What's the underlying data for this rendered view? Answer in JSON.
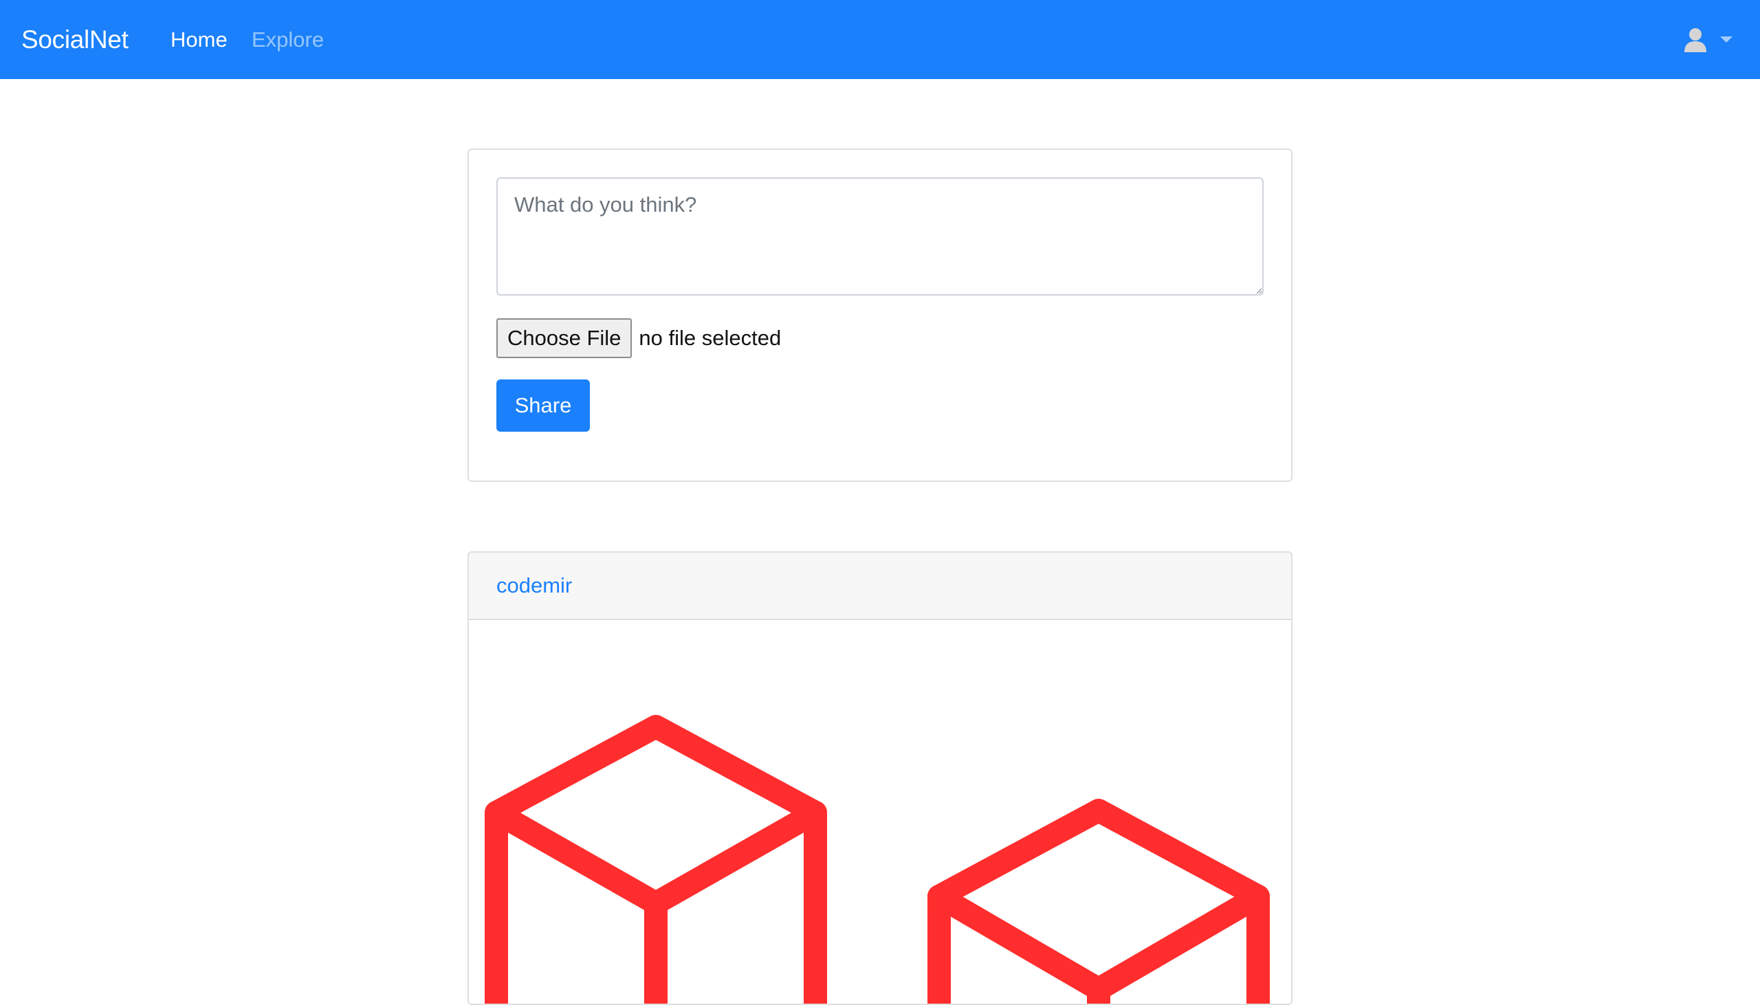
{
  "navbar": {
    "brand": "SocialNet",
    "links": [
      {
        "label": "Home",
        "active": true
      },
      {
        "label": "Explore",
        "active": false
      }
    ],
    "user_icon": "user-icon",
    "caret_icon": "caret-down-icon",
    "background_color": "#1a80fb"
  },
  "composer": {
    "placeholder": "What do you think?",
    "value": "",
    "file_button_label": "Choose File",
    "file_status": "no file selected",
    "share_label": "Share"
  },
  "feed": {
    "posts": [
      {
        "author": "codemir",
        "image": "laravel-logo-red-cubes",
        "image_color": "#ff2d2d"
      }
    ]
  }
}
